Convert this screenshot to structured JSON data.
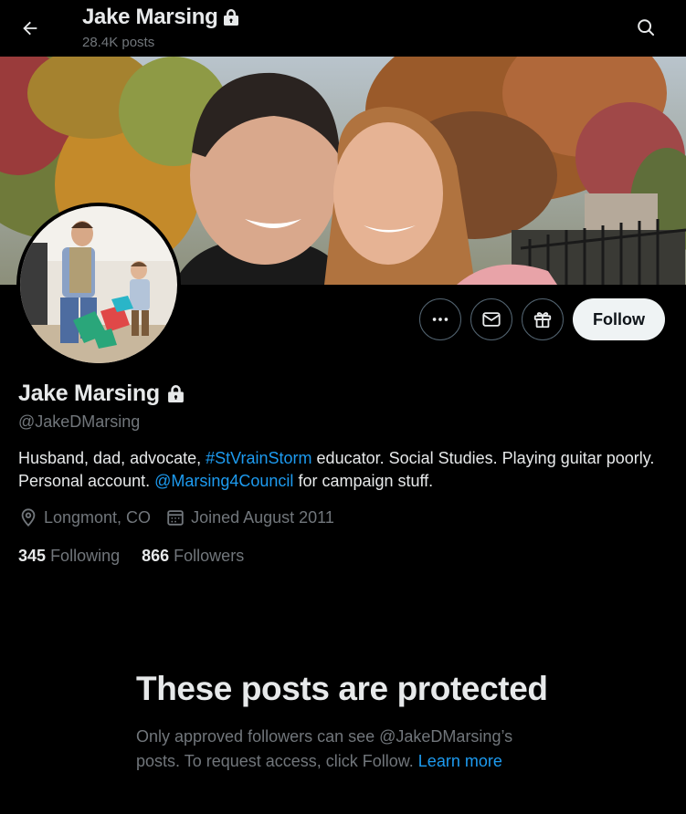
{
  "header": {
    "title": "Jake Marsing",
    "posts_count": "28.4K posts"
  },
  "profile": {
    "display_name": "Jake Marsing",
    "handle": "@JakeDMarsing",
    "bio_part1": "Husband, dad, advocate, ",
    "bio_hashtag": "#StVrainStorm",
    "bio_part2": " educator. Social Studies. Playing guitar poorly. Personal account. ",
    "bio_mention": "@Marsing4Council",
    "bio_part3": " for campaign stuff.",
    "location": "Longmont, CO",
    "joined": "Joined August 2011",
    "following_count": "345",
    "following_label": "Following",
    "followers_count": "866",
    "followers_label": "Followers"
  },
  "actions": {
    "more_icon": "ellipsis-icon",
    "message_icon": "envelope-icon",
    "subscribe_icon": "gift-icon",
    "follow_label": "Follow"
  },
  "protected": {
    "title": "These posts are protected",
    "body": "Only approved followers can see @JakeDMarsing’s posts. To request access, click Follow. ",
    "learn_more": "Learn more"
  },
  "colors": {
    "background": "#000000",
    "text_primary": "#e7e9ea",
    "text_secondary": "#71767b",
    "link": "#1d9bf0",
    "follow_bg": "#eff3f4"
  }
}
